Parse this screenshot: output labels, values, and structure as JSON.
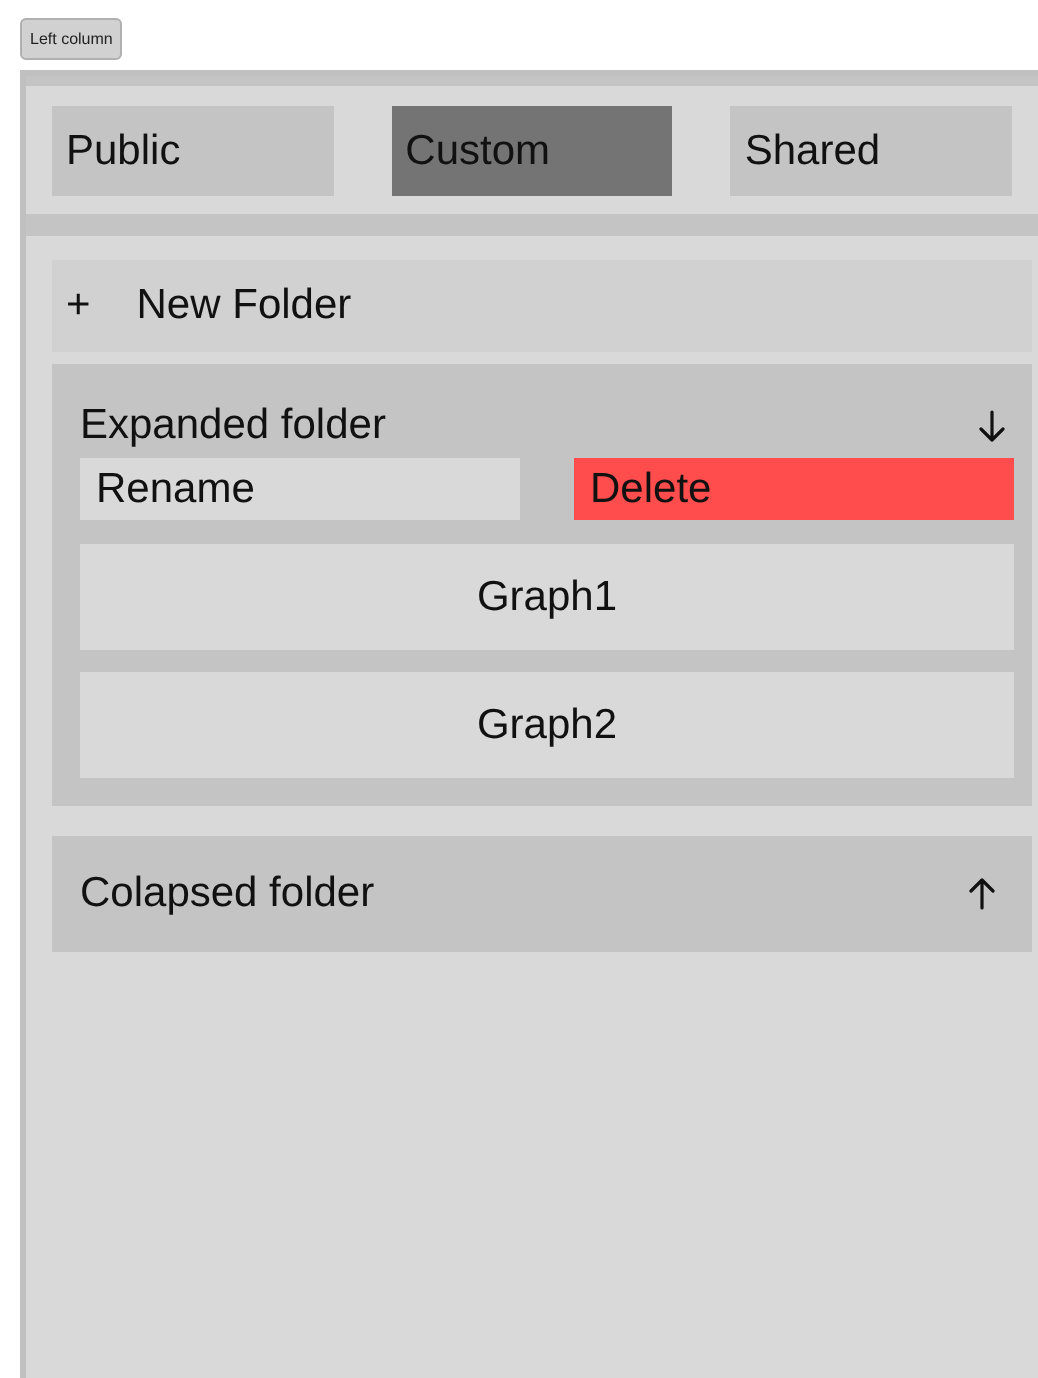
{
  "top_button": {
    "label": "Left column"
  },
  "tabs": [
    {
      "label": "Public",
      "selected": false
    },
    {
      "label": "Custom",
      "selected": true
    },
    {
      "label": "Shared",
      "selected": false
    }
  ],
  "new_folder": {
    "icon": "+",
    "label": "New Folder"
  },
  "folders": [
    {
      "name": "Expanded folder",
      "expanded": true,
      "actions": [
        {
          "label": "Rename",
          "kind": "rename"
        },
        {
          "label": "Delete",
          "kind": "delete"
        }
      ],
      "items": [
        "Graph1",
        "Graph2"
      ]
    },
    {
      "name": "Colapsed folder",
      "expanded": false
    }
  ]
}
